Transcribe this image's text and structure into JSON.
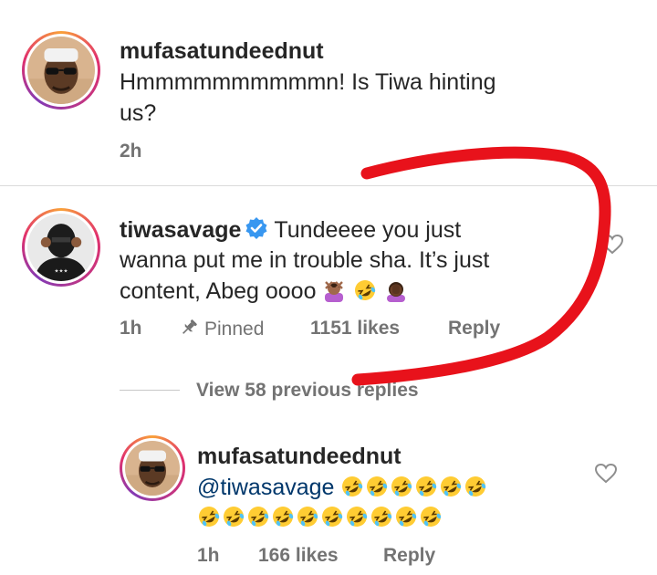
{
  "comments": [
    {
      "username": "mufasatundeednut",
      "text_line1": "Hmmmmmmmmmmn! Is Tiwa hinting",
      "text_line2": "us?",
      "time": "2h"
    },
    {
      "username": "tiwasavage",
      "verified": true,
      "text_line1": "Tundeeee you just",
      "text_line2": "wanna put me in trouble sha. It’s just",
      "text_line3": "content, Abeg oooo",
      "time": "1h",
      "pinned_label": "Pinned",
      "likes": "1151 likes",
      "reply_label": "Reply"
    }
  ],
  "view_replies_label": "View 58 previous replies",
  "reply": {
    "username": "mufasatundeednut",
    "mention": "@tiwasavage",
    "time": "1h",
    "likes": "166 likes",
    "reply_label": "Reply"
  },
  "colors": {
    "annotation_stroke": "#e8121b",
    "verified_badge": "#3897f0",
    "mention": "#00376b"
  },
  "icons": [
    "verified-badge-icon",
    "pin-icon",
    "heart-icon",
    "rofl-emoji",
    "woman-gesturing-no-emoji",
    "woman-facepalming-emoji"
  ]
}
